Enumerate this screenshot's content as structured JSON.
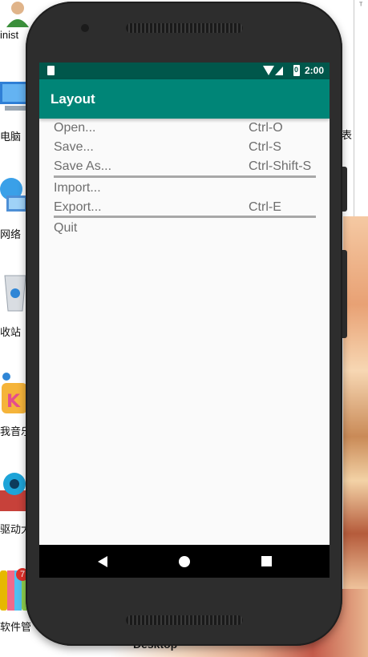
{
  "desktop": {
    "icons": [
      {
        "label": "inist",
        "icon": "admin-user-icon"
      },
      {
        "label": "电脑",
        "icon": "computer-icon"
      },
      {
        "label": "网络",
        "icon": "network-icon"
      },
      {
        "label": "收站",
        "icon": "recycle-bin-icon"
      },
      {
        "label": "我音乐",
        "icon": "music-app-icon"
      },
      {
        "label": "驱动大",
        "icon": "driver-tool-icon"
      },
      {
        "label": "软件管",
        "icon": "software-manager-icon"
      }
    ],
    "badge": "7",
    "bottom_label": "Desktop",
    "right_edge_char": "表"
  },
  "status_bar": {
    "time": "2:00",
    "battery_mark": "0"
  },
  "app_bar": {
    "title": "Layout"
  },
  "menu": {
    "rows": [
      {
        "label": "Open...",
        "shortcut": "Ctrl-O"
      },
      {
        "label": "Save...",
        "shortcut": "Ctrl-S"
      },
      {
        "label": "Save As...",
        "shortcut": "Ctrl-Shift-S"
      },
      {
        "label": "Import...",
        "shortcut": ""
      },
      {
        "label": "Export...",
        "shortcut": "Ctrl-E"
      },
      {
        "label": "Quit",
        "shortcut": ""
      }
    ]
  },
  "nav_bar": {
    "icons": [
      "back-icon",
      "home-icon",
      "recent-apps-icon"
    ]
  },
  "colors": {
    "status_bar": "#00574b",
    "app_bar": "#008577",
    "screen_bg": "#fafafa",
    "menu_text": "#6e6e6e",
    "separator": "#a8a8a8",
    "phone_body": "#2d2d2d"
  }
}
